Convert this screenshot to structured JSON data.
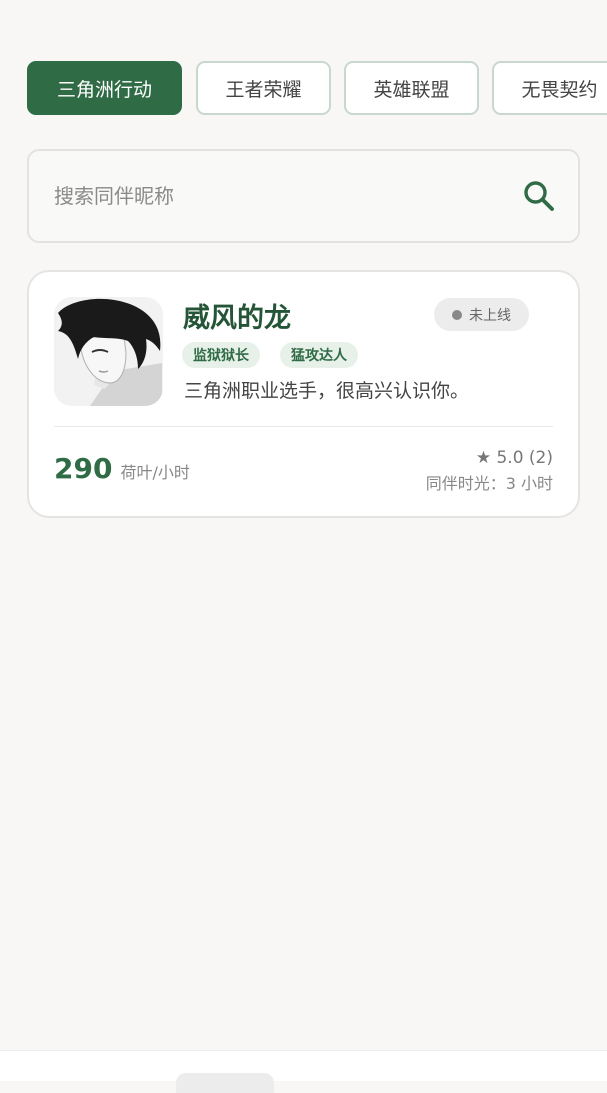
{
  "tabs": [
    {
      "label": "三角洲行动",
      "active": true
    },
    {
      "label": "王者荣耀",
      "active": false
    },
    {
      "label": "英雄联盟",
      "active": false
    },
    {
      "label": "无畏契约",
      "active": false
    }
  ],
  "search": {
    "placeholder": "搜索同伴昵称",
    "value": "",
    "icon": "search-icon"
  },
  "companion": {
    "name": "威风的龙",
    "status": "未上线",
    "tags": [
      "监狱狱长",
      "猛攻达人"
    ],
    "bio": "三角洲职业选手，很高兴认识你。",
    "price": "290",
    "price_unit": "荷叶/小时",
    "rating": "★ 5.0 (2)",
    "hours": "同伴时光：3 小时"
  },
  "colors": {
    "accent": "#2f6b45",
    "background": "#f8f7f5",
    "status_bg": "#ececec"
  }
}
